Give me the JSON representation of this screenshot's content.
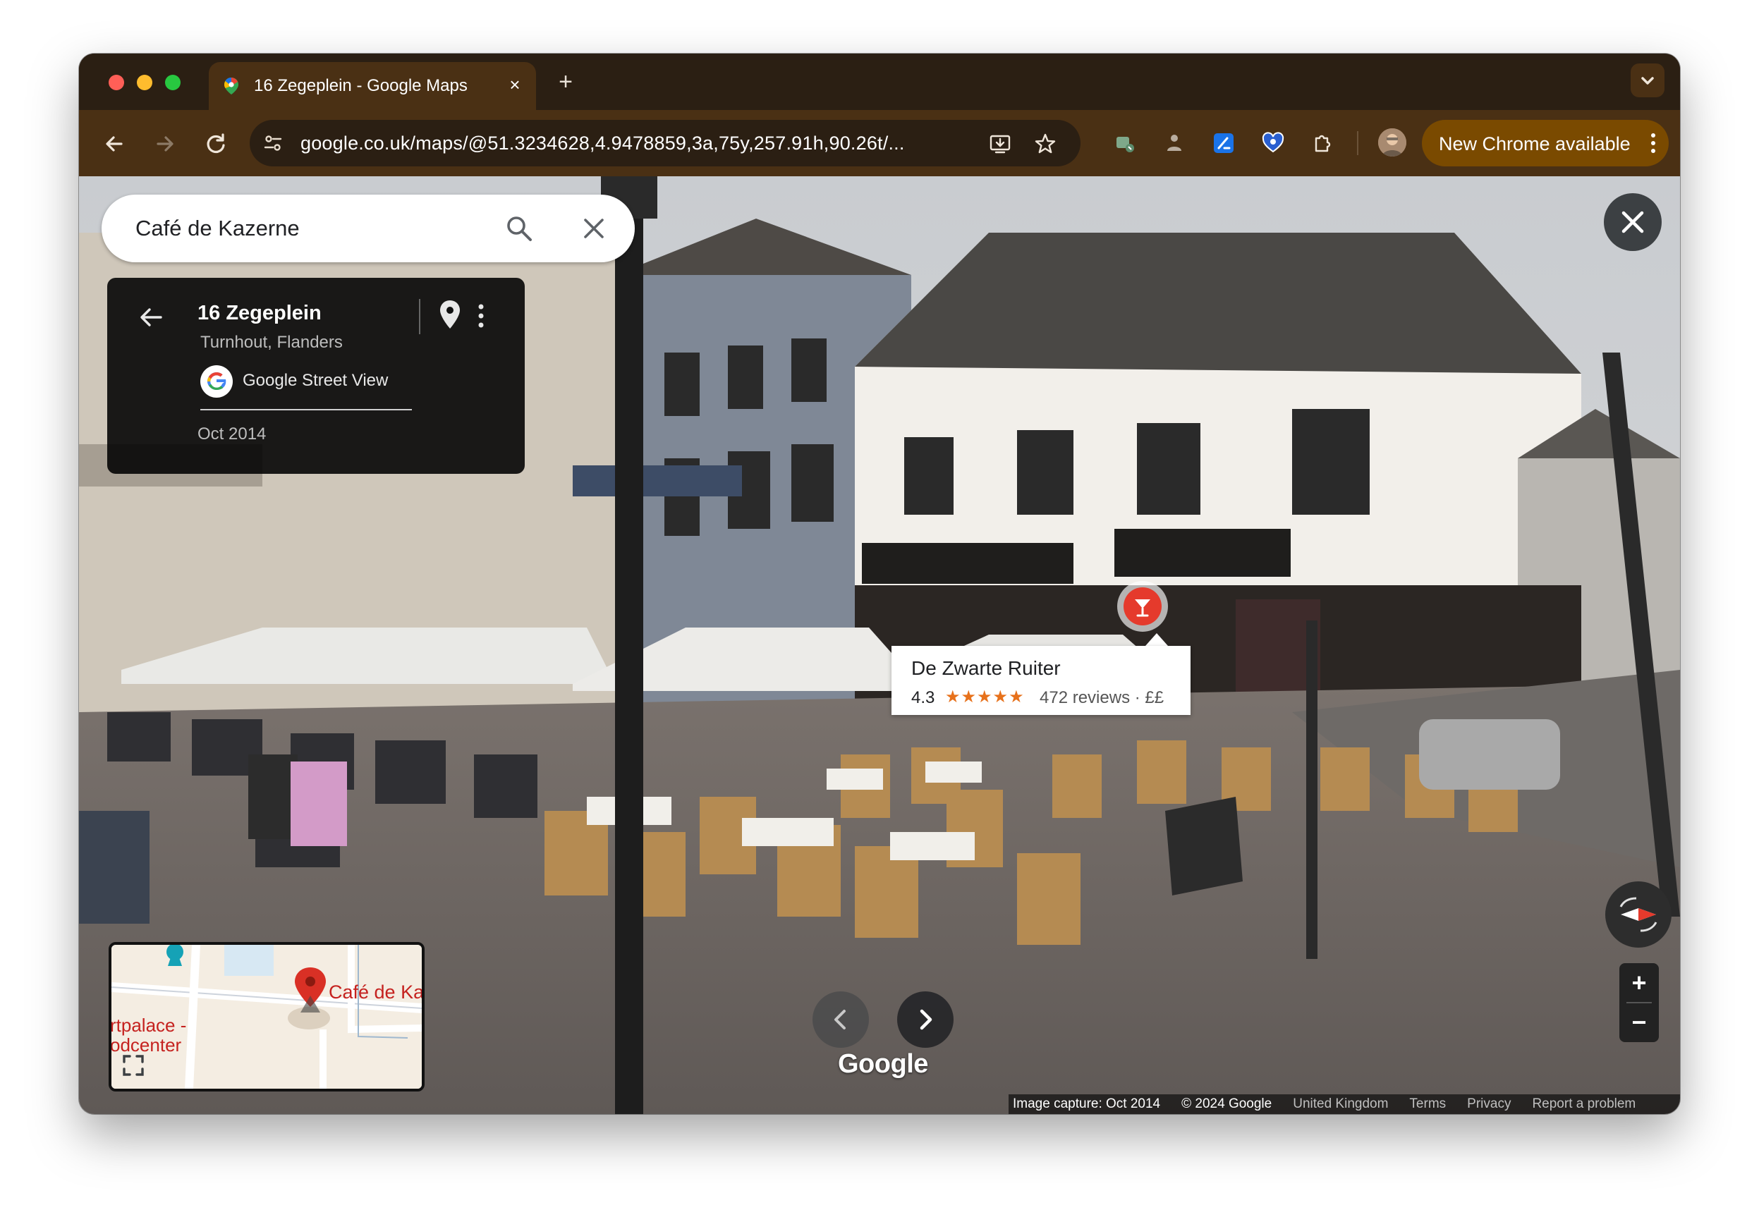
{
  "browser": {
    "tab": {
      "title": "16 Zegeplein - Google Maps"
    },
    "url": "google.co.uk/maps/@51.3234628,4.9478859,3a,75y,257.91h,90.26t/...",
    "update_button": "New Chrome available",
    "new_tab_symbol": "+",
    "close_symbol": "×"
  },
  "search": {
    "query": "Café de Kazerne"
  },
  "info_panel": {
    "title": "16 Zegeplein",
    "subtitle": "Turnhout, Flanders",
    "source": "Google Street View",
    "date": "Oct 2014"
  },
  "place_card": {
    "name": "De Zwarte Ruiter",
    "rating": "4.3",
    "stars": "★★★★★",
    "reviews": "472 reviews · ££"
  },
  "minimap": {
    "place_label": "Café de Ka",
    "side_label": "rtpalace -\nodcenter"
  },
  "google_logo": "Google",
  "zoom": {
    "in": "+",
    "out": "−"
  },
  "footer": {
    "capture": "Image capture: Oct 2014",
    "copyright": "© 2024 Google",
    "region": "United Kingdom",
    "terms": "Terms",
    "privacy": "Privacy",
    "report": "Report a problem"
  },
  "colors": {
    "tab_strip": "#2b1f13",
    "toolbar": "#4a3014",
    "update_button": "#7a4a00",
    "pin": "#e53a2c",
    "stars": "#e7711b"
  }
}
